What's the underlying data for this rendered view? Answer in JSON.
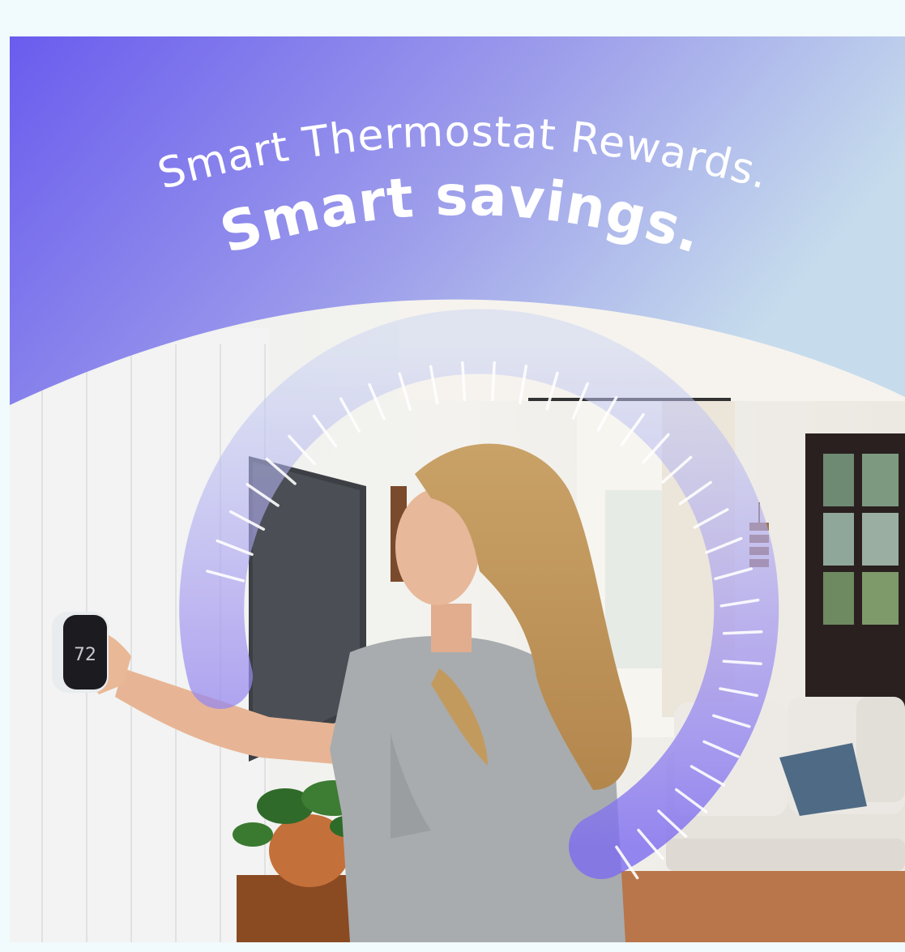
{
  "headline": {
    "line1": "Smart Thermostat Rewards.",
    "line2": "Smart savings."
  },
  "thermostat": {
    "display_value": "72"
  },
  "colors": {
    "page_bg": "#f1fafc",
    "gradient_start": "#6a5cee",
    "gradient_end": "#c6dcec",
    "arc_purple": "#8b7cf2",
    "arc_light": "#c7d2f3",
    "headline_text": "#ffffff"
  },
  "icons": [
    "thermostat-icon",
    "dial-arc-graphic"
  ]
}
